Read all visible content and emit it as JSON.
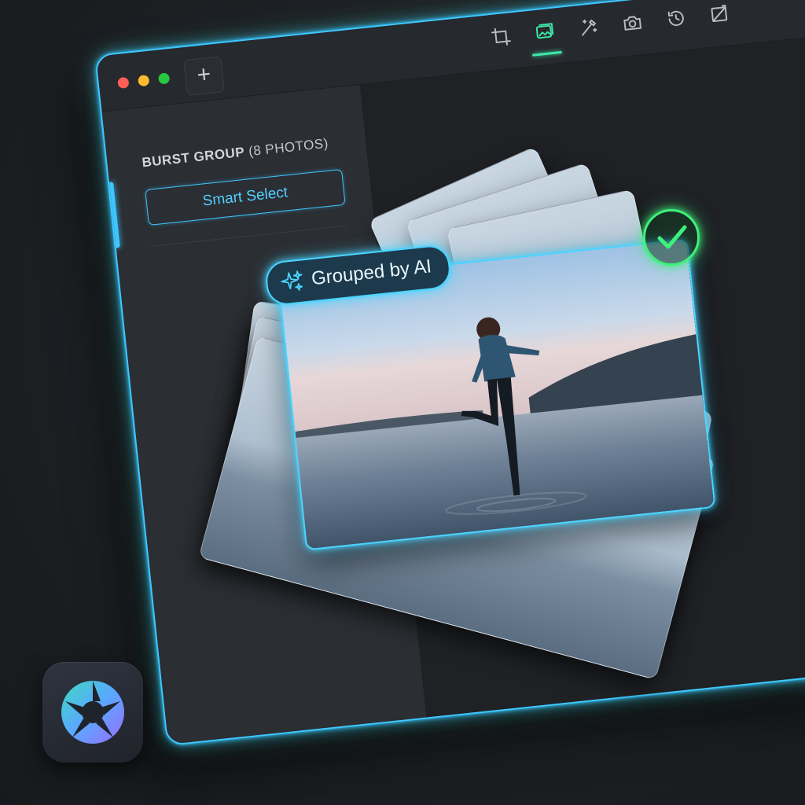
{
  "window": {
    "add_label": "+"
  },
  "toolbar": {
    "tools": [
      {
        "icon": "crop-icon",
        "active": false
      },
      {
        "icon": "gallery-icon",
        "active": true
      },
      {
        "icon": "magic-wand-icon",
        "active": false
      },
      {
        "icon": "camera-icon",
        "active": false
      },
      {
        "icon": "history-icon",
        "active": false
      },
      {
        "icon": "adjust-icon",
        "active": false
      }
    ]
  },
  "sidebar": {
    "group_title_bold": "BURST GROUP",
    "group_title_count": "(8 PHOTOS)",
    "smart_select_label": "Smart Select"
  },
  "badge": {
    "label": "Grouped by AI",
    "icon": "sparkle-icon"
  },
  "check": {
    "icon": "checkmark-icon"
  },
  "app": {
    "icon": "aperture-icon"
  },
  "colors": {
    "accent_blue": "#3fc6ff",
    "accent_green": "#3ef07a",
    "window_bg": "#24272b",
    "sidebar_bg": "#2b2e33"
  }
}
